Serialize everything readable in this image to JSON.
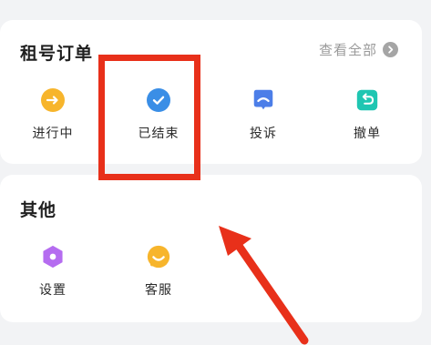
{
  "orders": {
    "title": "租号订单",
    "view_all": "查看全部",
    "items": [
      {
        "label": "进行中",
        "icon": "arrow-right-icon",
        "color": "#f7b52c"
      },
      {
        "label": "已结束",
        "icon": "check-icon",
        "color": "#3a8ee6"
      },
      {
        "label": "投诉",
        "icon": "complaint-icon",
        "color": "#4c7ee8"
      },
      {
        "label": "撤单",
        "icon": "undo-icon",
        "color": "#1fc6b2"
      }
    ]
  },
  "other": {
    "title": "其他",
    "items": [
      {
        "label": "设置",
        "icon": "settings-hexagon-icon",
        "color": "#b56cf0"
      },
      {
        "label": "客服",
        "icon": "customer-service-icon",
        "color": "#f7b52c"
      }
    ]
  },
  "annotation": {
    "highlight_color": "#e8301a"
  }
}
